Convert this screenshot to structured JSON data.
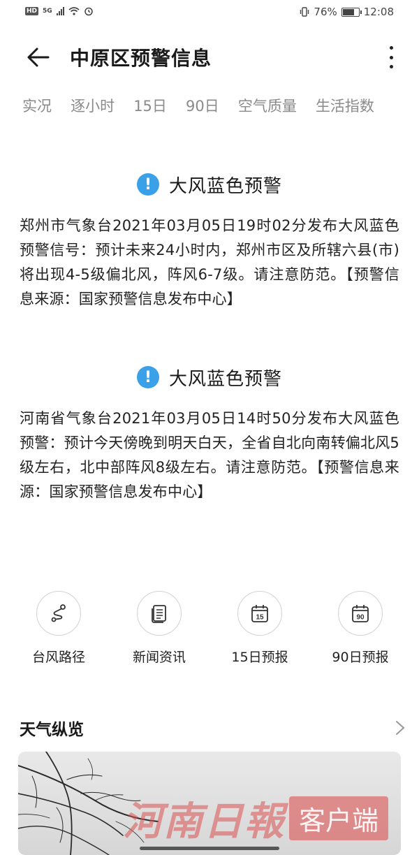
{
  "status_bar": {
    "hd": "HD",
    "network": "5G",
    "battery_percent": "76%",
    "time": "12:08"
  },
  "header": {
    "title": "中原区预警信息",
    "back_icon": "arrow-left-icon",
    "more_icon": "more-vertical-icon"
  },
  "tabs": [
    {
      "label": "实况"
    },
    {
      "label": "逐小时"
    },
    {
      "label": "15日"
    },
    {
      "label": "90日"
    },
    {
      "label": "空气质量"
    },
    {
      "label": "生活指数"
    }
  ],
  "warnings": [
    {
      "title": "大风蓝色预警",
      "body": "郑州市气象台2021年03月05日19时02分发布大风蓝色预警信号：预计未来24小时内，郑州市区及所辖六县(市)将出现4-5级偏北风，阵风6-7级。请注意防范。【预警信息来源：国家预警信息发布中心】"
    },
    {
      "title": "大风蓝色预警",
      "body": "河南省气象台2021年03月05日14时50分发布大风蓝色预警：预计今天傍晚到明天白天，全省自北向南转偏北风5级左右，北中部阵风8级左右。请注意防范。【预警信息来源：国家预警信息发布中心】"
    }
  ],
  "shortcuts": [
    {
      "label": "台风路径",
      "icon": "typhoon-path-icon"
    },
    {
      "label": "新闻资讯",
      "icon": "news-icon"
    },
    {
      "label": "15日预报",
      "icon": "calendar-15-icon",
      "badge": "15"
    },
    {
      "label": "90日预报",
      "icon": "calendar-90-icon",
      "badge": "90"
    }
  ],
  "overview": {
    "title": "天气纵览",
    "chevron_icon": "chevron-right-icon"
  },
  "watermark": {
    "name": "河南日報",
    "tag": "客户端"
  },
  "colors": {
    "accent": "#3aa0e8",
    "tab_text": "#8a8a8a",
    "watermark": "#dc5050"
  }
}
